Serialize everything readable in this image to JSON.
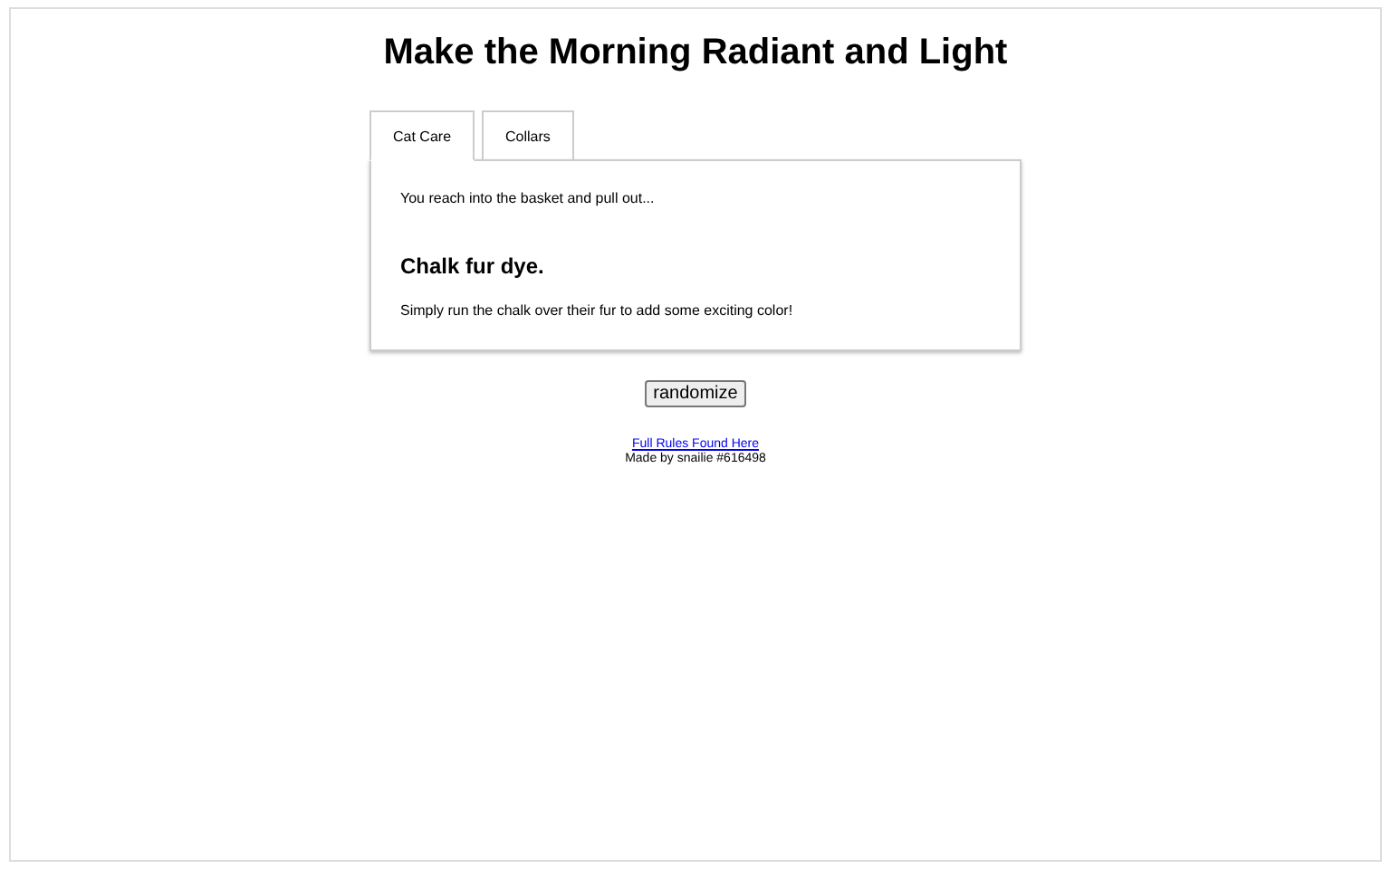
{
  "title": "Make the Morning Radiant and Light",
  "tabs": [
    {
      "label": "Cat Care",
      "selected": true
    },
    {
      "label": "Collars",
      "selected": false
    }
  ],
  "panel": {
    "intro": "You reach into the basket and pull out...",
    "item_title": "Chalk fur dye.",
    "description": "Simply run the chalk over their fur to add some exciting color!"
  },
  "button": "randomize",
  "footer": {
    "link": "Full Rules Found Here",
    "credit": "Made by snailie #616498"
  }
}
